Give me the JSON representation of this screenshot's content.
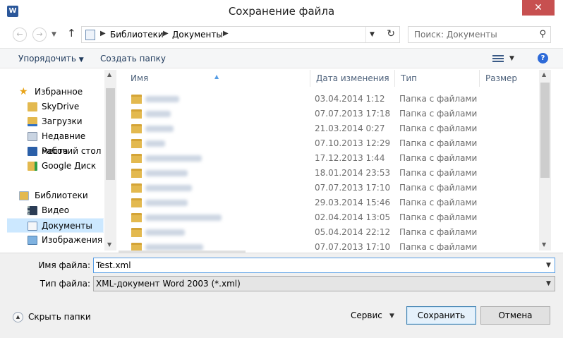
{
  "window": {
    "app_icon": "W",
    "title": "Сохранение файла",
    "close_label": "✕"
  },
  "address": {
    "back_icon": "←",
    "forward_icon": "→",
    "up_icon": "↑",
    "crumbs": [
      "Библиотеки",
      "Документы"
    ],
    "search_placeholder": "Поиск: Документы"
  },
  "toolbar": {
    "organize_label": "Упорядочить",
    "new_folder_label": "Создать папку",
    "help_label": "?"
  },
  "nav": {
    "favorites_label": "Избранное",
    "favorites": [
      "SkyDrive",
      "Загрузки",
      "Недавние места",
      "Рабочий стол",
      "Google Диск"
    ],
    "libraries_label": "Библиотеки",
    "libraries": [
      "Видео",
      "Документы",
      "Изображения"
    ],
    "selected": "Документы"
  },
  "columns": {
    "name": "Имя",
    "date": "Дата изменения",
    "type": "Тип",
    "size": "Размер"
  },
  "files": [
    {
      "date": "03.04.2014 1:12",
      "type": "Папка с файлами"
    },
    {
      "date": "07.07.2013 17:18",
      "type": "Папка с файлами"
    },
    {
      "date": "21.03.2014 0:27",
      "type": "Папка с файлами"
    },
    {
      "date": "07.10.2013 12:29",
      "type": "Папка с файлами"
    },
    {
      "date": "17.12.2013 1:44",
      "type": "Папка с файлами"
    },
    {
      "date": "18.01.2014 23:53",
      "type": "Папка с файлами"
    },
    {
      "date": "07.07.2013 17:10",
      "type": "Папка с файлами"
    },
    {
      "date": "29.03.2014 15:46",
      "type": "Папка с файлами"
    },
    {
      "date": "02.04.2014 13:05",
      "type": "Папка с файлами"
    },
    {
      "date": "05.04.2014 22:12",
      "type": "Папка с файлами"
    },
    {
      "date": "07.07.2013 17:10",
      "type": "Папка с файлами"
    }
  ],
  "form": {
    "filename_label": "Имя файла:",
    "filename_value": "Test.xml",
    "filetype_label": "Тип файла:",
    "filetype_value": "XML-документ Word 2003 (*.xml)"
  },
  "footer": {
    "hide_folders_label": "Скрыть папки",
    "service_label": "Сервис",
    "save_label": "Сохранить",
    "cancel_label": "Отмена"
  },
  "colors": {
    "selection": "#cce8ff",
    "focus_border": "#569de5",
    "folder": "#e3b94f",
    "close": "#c75050"
  }
}
